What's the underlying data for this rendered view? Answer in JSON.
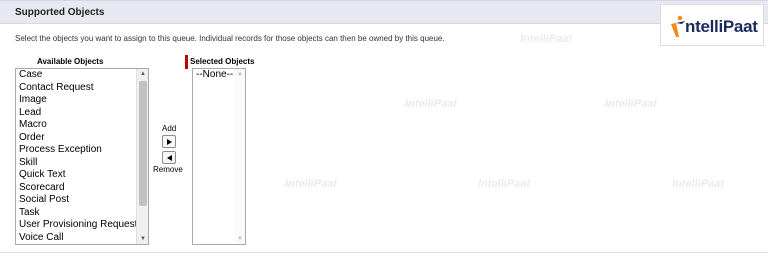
{
  "section": {
    "title": "Supported Objects"
  },
  "instructions": "Select the objects you want to assign to this queue. Individual records for those objects can then be owned by this queue.",
  "logo": {
    "text": "ntelliPaat",
    "icon": "intellipaat-logo-icon"
  },
  "watermark": "IntelliPaat",
  "available": {
    "header": "Available Objects",
    "items": [
      "Case",
      "Contact Request",
      "Image",
      "Lead",
      "Macro",
      "Order",
      "Process Exception",
      "Skill",
      "Quick Text",
      "Scorecard",
      "Social Post",
      "Task",
      "User Provisioning Request",
      "Voice Call"
    ]
  },
  "selected": {
    "header": "Selected Objects",
    "items": [
      "--None--"
    ]
  },
  "buttons": {
    "add_label": "Add",
    "remove_label": "Remove"
  },
  "colors": {
    "header_bg": "#e8e8f3",
    "required": "#c00000",
    "logo_text": "#1a2a5e",
    "logo_accent": "#f28c1a"
  }
}
